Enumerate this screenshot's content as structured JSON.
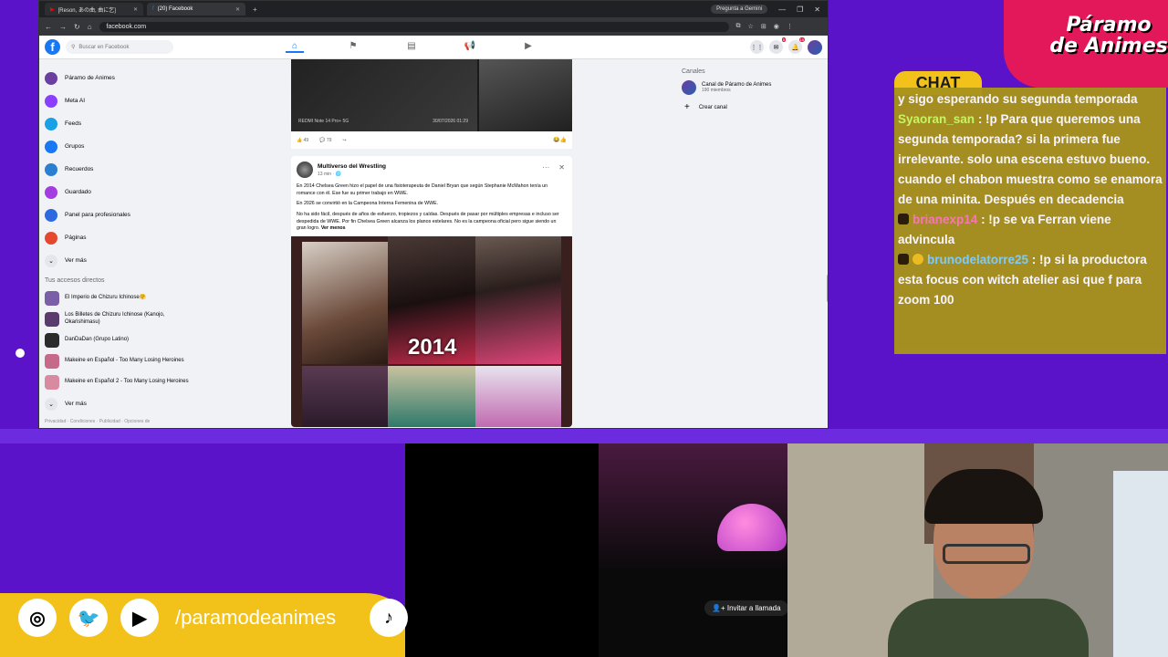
{
  "browser": {
    "tabs": [
      {
        "label": "[Reson, あの曲, 曲に乞]",
        "active": false
      },
      {
        "label": "(20) Facebook",
        "active": true
      }
    ],
    "gemini_button": "Pregunta a Gemini",
    "url": "facebook.com"
  },
  "facebook": {
    "search_placeholder": "Buscar en Facebook",
    "notif_badge": "5",
    "msg_badge": "15",
    "sidebar": [
      {
        "label": "Páramo de Animes",
        "icon": "page-avatar-icon",
        "color": "#6b3fa0"
      },
      {
        "label": "Meta AI",
        "icon": "meta-ai-icon",
        "color": "#8a3ffc"
      },
      {
        "label": "Feeds",
        "icon": "feeds-icon",
        "color": "#1aa0e6"
      },
      {
        "label": "Grupos",
        "icon": "groups-icon",
        "color": "#1877f2"
      },
      {
        "label": "Recuerdos",
        "icon": "memories-icon",
        "color": "#2a7fd1"
      },
      {
        "label": "Guardado",
        "icon": "saved-icon",
        "color": "#a33de0"
      },
      {
        "label": "Panel para profesionales",
        "icon": "dashboard-icon",
        "color": "#2d6ae0"
      },
      {
        "label": "Páginas",
        "icon": "pages-icon",
        "color": "#e6482f"
      },
      {
        "label": "Ver más",
        "icon": "chevron-down-icon",
        "color": "#e4e6eb"
      }
    ],
    "shortcuts_title": "Tus accesos directos",
    "shortcuts": [
      {
        "label": "El Imperio de Chizuru Ichinose🤗",
        "color": "#7a5fa8"
      },
      {
        "label": "Los Billetes de Chizuru Ichinose (Kanojo, Okarishimasu)",
        "color": "#5b3a6e"
      },
      {
        "label": "DanDaDan (Grupo Latino)",
        "color": "#2b2b2b"
      },
      {
        "label": "Makeine en Español - Too Many Losing Heroines",
        "color": "#c76a8a"
      },
      {
        "label": "Makeine en Español 2 - Too Many Losing Heroines",
        "color": "#d88aa0"
      }
    ],
    "shortcuts_more": "Ver más",
    "footer": "Privacidad · Condiciones · Publicidad · Opciones de",
    "video": {
      "watermark": "REDMI Note 14 Pro+ 5G",
      "date": "30/07/2026 01:29",
      "likes": "49",
      "comments": "79"
    },
    "post": {
      "author": "Multiverso del Wrestling",
      "time": "13 min · 🌐",
      "paragraphs": [
        "En 2014 Chelsea Green hizo el papel de una fisioterapeuta de Daniel Bryan que según Stephanie McMahon tenía un romance con él. Ese fue su primer trabajo en WWE.",
        "En 2026 se convirtió en la Campeona Interna Femenina de WWE.",
        "No ha sido fácil, después de años de esfuerzo, tropiezos y caídas. Después de pasar por múltiples empresas e incluso ser despedida de WWE. Por fin Chelsea Green alcanza los planos estelares. No es la campeona oficial pero sigue siendo un gran logro."
      ],
      "see_more": "Ver menos",
      "image_year": "2014"
    },
    "right": {
      "title": "Canales",
      "channel_name": "Canal de Páramo de Animes",
      "channel_members": "190 miembros",
      "create": "Crear canal"
    }
  },
  "stream": {
    "brand": "Páramo de Animes",
    "chat_label": "CHAT",
    "chat": [
      {
        "user": "",
        "text": "y sigo esperando su segunda temporada",
        "user_color": "",
        "truncated_top": true
      },
      {
        "user": "Syaoran_san",
        "text": ": !p Para que queremos una segunda temporada? si la primera fue irrelevante. solo una escena estuvo bueno. cuando el chabon muestra como se enamora de una minita. Después en decadencia",
        "user_class": "u1"
      },
      {
        "user": "brianexp14",
        "text": ": !p se va Ferran viene advincula",
        "user_class": "u2"
      },
      {
        "user": "brunodelatorre25",
        "text": ": !p si la productora esta focus con witch atelier asi que f para zoom 100",
        "user_class": "u3"
      }
    ],
    "invite": "Invitar a llamada",
    "social_handle": "/paramodeanimes",
    "social_icons": [
      "instagram-icon",
      "twitter-icon",
      "youtube-icon",
      "tiktok-icon"
    ]
  }
}
